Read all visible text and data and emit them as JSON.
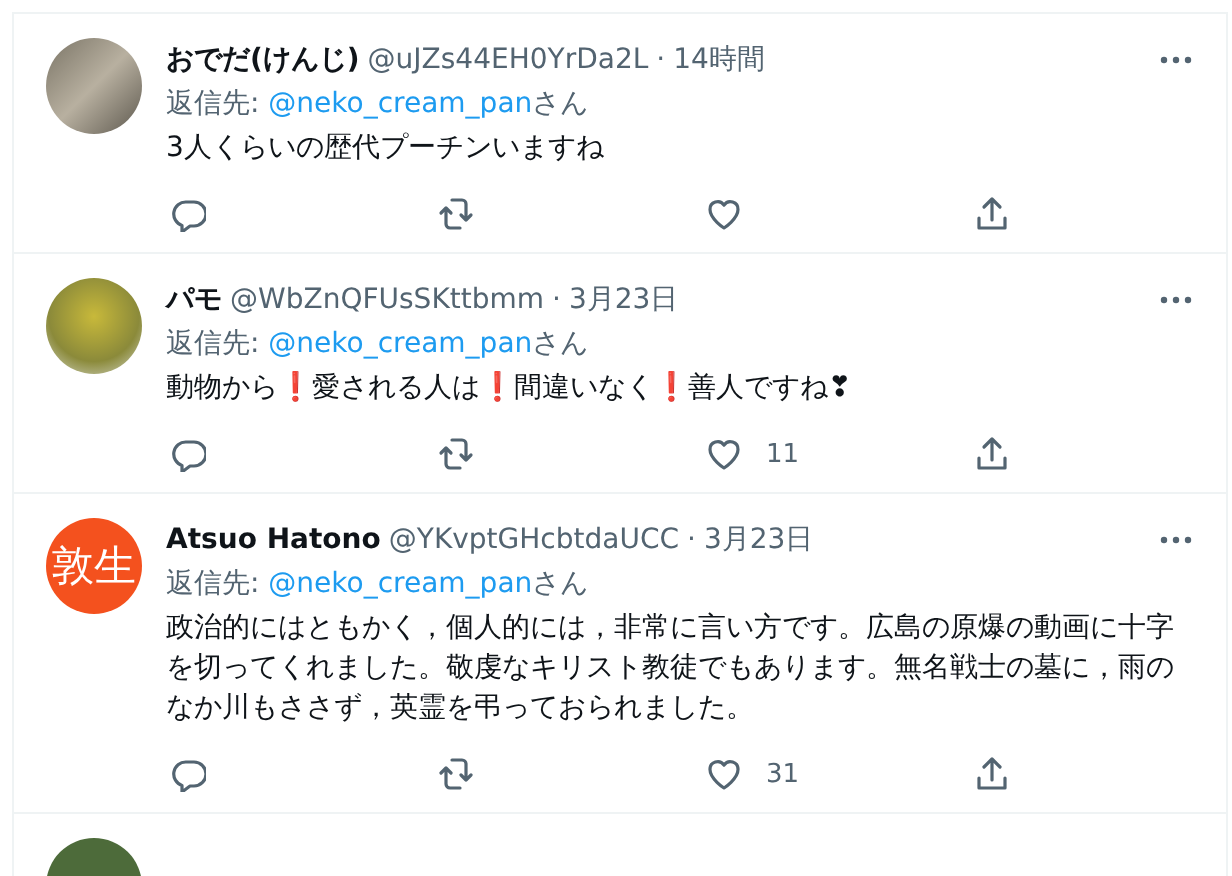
{
  "tweets": [
    {
      "avatar": {
        "kind": "photo"
      },
      "name": "おでだ(けんじ)",
      "handle": "@uJZs44EH0YrDa2L",
      "separator": "·",
      "time": "14時間",
      "reply_label": "返信先:",
      "reply_handle": "@neko_cream_pan",
      "reply_suffix": "さん",
      "body": "3人くらいの歴代プーチンいますね"
    },
    {
      "avatar": {
        "kind": "photo"
      },
      "name": "パモ",
      "handle": "@WbZnQFUsSKttbmm",
      "separator": "·",
      "time": "3月23日",
      "reply_label": "返信先:",
      "reply_handle": "@neko_cream_pan",
      "reply_suffix": "さん",
      "body": "動物から❗愛される人は❗間違いなく❗善人ですね❣",
      "like_count": "11"
    },
    {
      "avatar": {
        "kind": "text",
        "text": "敦生",
        "color": "#f4511e"
      },
      "name": "Atsuo Hatono",
      "handle": "@YKvptGHcbtdaUCC",
      "separator": "·",
      "time": "3月23日",
      "reply_label": "返信先:",
      "reply_handle": "@neko_cream_pan",
      "reply_suffix": "さん",
      "body": "政治的にはともかく，個人的には，非常に言い方です。広島の原爆の動画に十字を切ってくれました。敬虔なキリスト教徒でもあります。無名戦士の墓に，雨のなか川もささず，英霊を弔っておられました。",
      "like_count": "31"
    }
  ],
  "partial_tweet": {
    "avatar": {
      "kind": "photo"
    }
  }
}
